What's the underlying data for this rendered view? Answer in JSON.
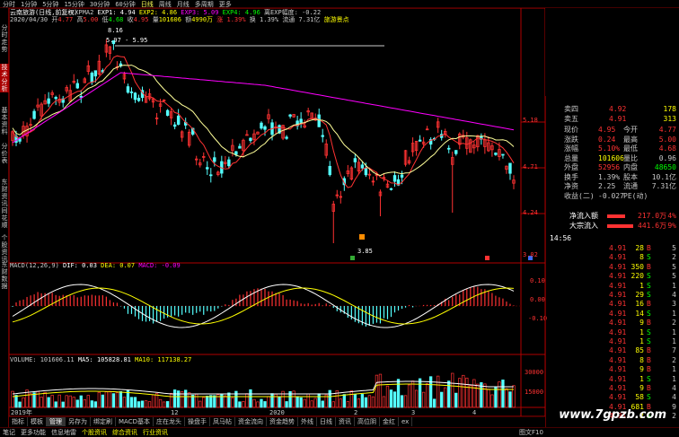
{
  "colors": {
    "up": "#ff3232",
    "down": "#54ffff",
    "ma5": "#ffffff",
    "ma10": "#ffff00",
    "ma20": "#ff00ff",
    "axis": "#b00000",
    "green": "#00ff00",
    "yellow": "#ffff00"
  },
  "top_tabs": [
    "分时",
    "1分钟",
    "5分钟",
    "15分钟",
    "30分钟",
    "60分钟",
    "日线",
    "周线",
    "月线",
    "多周期",
    "更多"
  ],
  "left_tabs": [
    "分时走势",
    "技术分析",
    "基本资料",
    "分价表",
    "东财资讯",
    "同花顺",
    "个股资讯",
    "东财数据"
  ],
  "header": {
    "title": "云南旅游(日线,前复权)",
    "date": "2020/04/30",
    "open_label": "开",
    "open": "4.77",
    "high_label": "高",
    "high": "5.00",
    "low_label": "低",
    "low": "4.68",
    "close_label": "收",
    "close": "4.95",
    "volume_label": "量",
    "volume": "101606",
    "amount_label": "额",
    "amount": "4990万",
    "change": "涨 1.39%",
    "turnover": "换 1.39%",
    "circ": "流通 7.31亿",
    "theme": "旅游景点"
  },
  "ma_legend": {
    "name": "EXPMA2",
    "exp1": "EXP1: 4.94",
    "exp2": "EXP2: 4.86",
    "exp3": "EXP3: 5.09",
    "exp4": "EXP4: 4.96",
    "extra": "离EXP幅度: -0.22"
  },
  "price_labels": {
    "high_mark": "8.16",
    "range_mark": "5.97 - 5.95",
    "low_mark": "3.85"
  },
  "right_axis_price": [
    "5.18",
    "4.71",
    "4.24",
    "3.02"
  ],
  "macd_legend": {
    "name": "MACD(12,26,9)",
    "dif": "DIF: 0.03",
    "dea": "DEA: 0.07",
    "macd": "MACD: -0.09"
  },
  "right_axis_macd": [
    "0.10",
    "0.00",
    "-0.10"
  ],
  "vol_legend": {
    "name": "VOLUME: 101606.11",
    "ma5": "MA5: 105828.81",
    "ma10": "MA10: 117138.27"
  },
  "right_axis_vol": [
    "30000",
    "15000"
  ],
  "date_ticks": [
    "2019年",
    "12",
    "2020",
    "2",
    "3",
    "4"
  ],
  "quote": {
    "sell_rows": [
      {
        "label": "卖四",
        "price": "4.92",
        "vol": "178"
      },
      {
        "label": "卖五",
        "price": "4.91",
        "vol": "313"
      }
    ],
    "stats": [
      {
        "l1": "现价",
        "v1": "4.95",
        "l2": "今开",
        "v2": "4.77"
      },
      {
        "l1": "涨跌",
        "v1": "0.24",
        "l2": "最高",
        "v2": "5.00"
      },
      {
        "l1": "涨幅",
        "v1": "5.10%",
        "l2": "最低",
        "v2": "4.68"
      },
      {
        "l1": "总量",
        "v1": "101606",
        "l2": "量比",
        "v2": "0.96"
      },
      {
        "l1": "外盘",
        "v1": "52956",
        "l2": "内盘",
        "v2": "48650"
      },
      {
        "l1": "换手",
        "v1": "1.39%",
        "l2": "股本",
        "v2": "10.1亿"
      },
      {
        "l1": "净资",
        "v1": "2.25",
        "l2": "流通",
        "v2": "7.31亿"
      },
      {
        "l1": "收益(二)",
        "v1": "-0.027",
        "l2": "PE(动)",
        "v2": ""
      }
    ],
    "flows": [
      {
        "label": "净流入额",
        "value": "217.0万",
        "pct": "4%",
        "bar": 0.6
      },
      {
        "label": "大宗流入",
        "value": "441.6万",
        "pct": "9%",
        "bar": 0.85
      }
    ],
    "ticks_time": "14:56",
    "ticks": [
      {
        "p": "4.91",
        "v": "28",
        "s": "B",
        "n": "5"
      },
      {
        "p": "4.91",
        "v": "8",
        "s": "S",
        "n": "2"
      },
      {
        "p": "4.91",
        "v": "350",
        "s": "B",
        "n": "5"
      },
      {
        "p": "4.91",
        "v": "220",
        "s": "S",
        "n": "5"
      },
      {
        "p": "4.91",
        "v": "1",
        "s": "S",
        "n": "1"
      },
      {
        "p": "4.91",
        "v": "29",
        "s": "S",
        "n": "4"
      },
      {
        "p": "4.91",
        "v": "16",
        "s": "B",
        "n": "3"
      },
      {
        "p": "4.91",
        "v": "14",
        "s": "S",
        "n": "1"
      },
      {
        "p": "4.91",
        "v": "9",
        "s": "B",
        "n": "2"
      },
      {
        "p": "4.91",
        "v": "1",
        "s": "S",
        "n": "1"
      },
      {
        "p": "4.91",
        "v": "1",
        "s": "S",
        "n": "1"
      },
      {
        "p": "4.91",
        "v": "85",
        "s": "B",
        "n": "7"
      },
      {
        "p": "4.91",
        "v": "8",
        "s": "B",
        "n": "2"
      },
      {
        "p": "4.91",
        "v": "9",
        "s": "B",
        "n": "1"
      },
      {
        "p": "4.91",
        "v": "1",
        "s": "S",
        "n": "1"
      },
      {
        "p": "4.91",
        "v": "9",
        "s": "B",
        "n": "4"
      },
      {
        "p": "4.91",
        "v": "58",
        "s": "S",
        "n": "4"
      },
      {
        "p": "4.91",
        "v": "681",
        "s": "B",
        "n": "9"
      },
      {
        "p": "4.91",
        "v": "2",
        "s": "S",
        "n": "2"
      }
    ]
  },
  "bottom_tabs": [
    "指标",
    "模板",
    "管理",
    "另存为",
    "绑定刷",
    "MACD基本",
    "庄在龙头",
    "操盘手",
    "凤马帖",
    "资金流向",
    "资金趋势",
    "外线",
    "日线",
    "资讯",
    "高位阴",
    "金红",
    "ex"
  ],
  "status": [
    "笔记",
    "更多功能",
    "信息地雷",
    "个股资讯",
    "综合资讯",
    "行业资讯",
    "图文F10"
  ],
  "watermark": "www.7gpzb.com"
}
